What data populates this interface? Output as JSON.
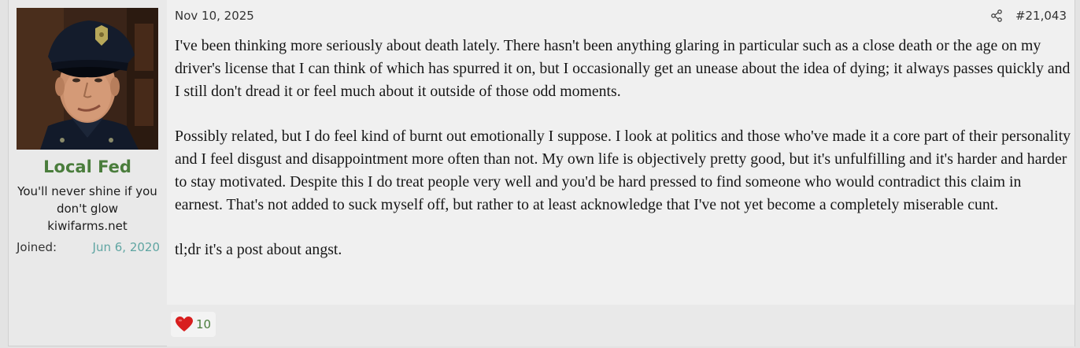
{
  "user": {
    "name": "Local Fed",
    "title": "You'll never shine if you don't glow",
    "site": "kiwifarms.net",
    "joined_label": "Joined:",
    "joined_date": "Jun 6, 2020",
    "avatar_icon": "police-officer-avatar"
  },
  "post": {
    "date": "Nov 10, 2025",
    "number": "#21,043",
    "share_icon": "share-icon",
    "paragraphs": [
      "I've been thinking more seriously about death lately. There hasn't been anything glaring in particular such as a close death or the age on my driver's license that I can think of which has spurred it on, but I occasionally get an unease about the idea of dying; it always passes quickly and I still don't dread it or feel much about it outside of those odd moments.",
      "Possibly related, but I do feel kind of burnt out emotionally I suppose. I look at politics and those who've made it a core part of their personality and I feel disgust and disappointment more often than not. My own life is objectively pretty good, but it's unfulfilling and it's harder and harder to stay motivated. Despite this I do treat people very well and you'd be hard pressed to find someone who would contradict this claim in earnest. That's not added to suck myself off, but rather to at least acknowledge that I've not yet become a completely miserable cunt.",
      "tl;dr it's a post about angst."
    ]
  },
  "reactions": {
    "icon": "heart-icon",
    "count": "10"
  },
  "colors": {
    "username": "#4a7d3c",
    "joined_date": "#5fa5a2",
    "reaction_count": "#4a7d3c",
    "heart": "#d81e1e"
  }
}
